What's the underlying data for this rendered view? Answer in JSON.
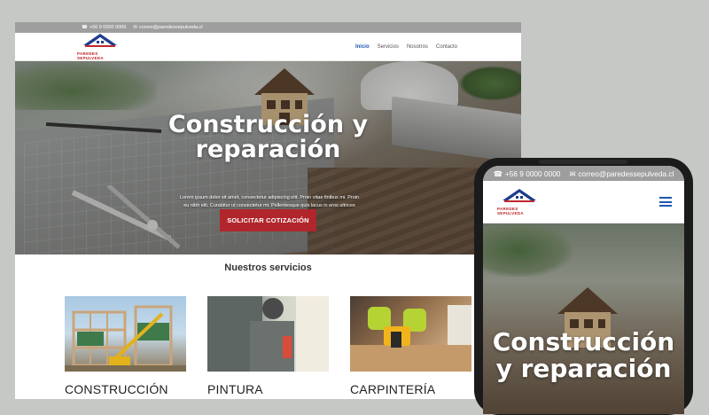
{
  "site": {
    "phone": "+56 9 0000 0000",
    "email": "correo@paredessepulveda.cl",
    "logo_text": "PAREDES SEPULVEDA",
    "nav": [
      "Inicio",
      "Servicios",
      "Nosotros",
      "Contacto"
    ],
    "active_nav": "Inicio"
  },
  "hero": {
    "title_line1": "Construcción y",
    "title_line2": "reparación",
    "body": "Lorem ipsum dolor sit amet, consectetur adipiscing elit. Proin vitae finibus mi. Proin eu nibh elit. Curabitur ut consectetur mi. Pellentesque quis lacus in eros ultrices dignissim.",
    "cta": "SOLICITAR COTIZACIÓN"
  },
  "services": {
    "title": "Nuestros servicios",
    "items": [
      {
        "label": "CONSTRUCCIÓN"
      },
      {
        "label": "PINTURA"
      },
      {
        "label": "CARPINTERÍA"
      }
    ]
  },
  "mobile": {
    "phone": "+56 9 0000 0000",
    "email": "correo@paredessepulveda.cl",
    "logo_text": "PAREDES SEPULVEDA",
    "title_line1": "Construcción",
    "title_line2": "y reparación"
  },
  "colors": {
    "brand_blue": "#1e56b0",
    "cta_red": "#b0262c",
    "topbar_gray": "#9e9e9e"
  },
  "icons": [
    "phone-icon",
    "mail-icon",
    "hamburger-menu-icon"
  ]
}
